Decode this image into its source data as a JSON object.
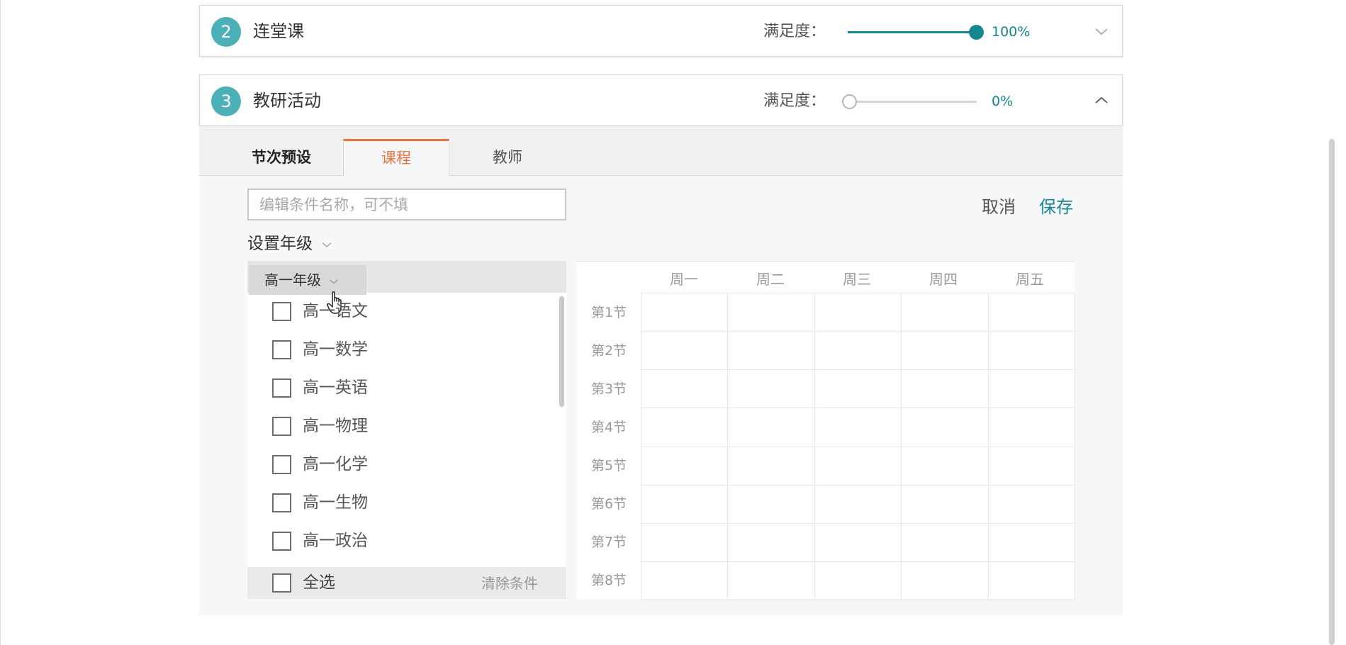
{
  "panels": [
    {
      "number": "2",
      "title": "连堂课",
      "satisfaction_label": "满足度：",
      "satisfaction_value": "100%",
      "satisfaction_fraction": 1.0,
      "expanded": false
    },
    {
      "number": "3",
      "title": "教研活动",
      "satisfaction_label": "满足度：",
      "satisfaction_value": "0%",
      "satisfaction_fraction": 0.0,
      "expanded": true
    }
  ],
  "tabs": [
    {
      "label": "节次预设",
      "active": false
    },
    {
      "label": "课程",
      "active": true
    },
    {
      "label": "教师",
      "active": false
    }
  ],
  "form": {
    "name_placeholder": "编辑条件名称，可不填",
    "name_value": "",
    "cancel_label": "取消",
    "save_label": "保存"
  },
  "grade": {
    "label": "设置年级",
    "selected": "高一年级",
    "courses": [
      "高一语文",
      "高一数学",
      "高一英语",
      "高一物理",
      "高一化学",
      "高一生物",
      "高一政治"
    ],
    "select_all_label": "全选",
    "clear_label": "清除条件"
  },
  "timetable": {
    "days": [
      "周一",
      "周二",
      "周三",
      "周四",
      "周五"
    ],
    "periods": [
      "第1节",
      "第2节",
      "第3节",
      "第4节",
      "第5节",
      "第6节",
      "第7节",
      "第8节"
    ]
  },
  "colors": {
    "accent": "#16878f",
    "badge": "#4bb0b8",
    "tab_active": "#e8733f"
  }
}
